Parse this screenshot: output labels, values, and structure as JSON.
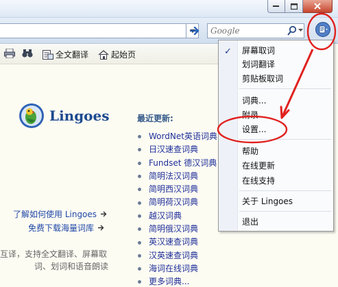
{
  "window": {
    "title": ""
  },
  "address": {
    "value": ""
  },
  "search": {
    "placeholder": "Google"
  },
  "page_toolbar": {
    "items": [
      {
        "label": ""
      },
      {
        "label": ""
      },
      {
        "label": "全文翻译"
      },
      {
        "label": "起始页"
      }
    ]
  },
  "home": {
    "logo_text": "Lingoes",
    "links": [
      "了解如何使用 Lingoes",
      "免费下载海量词库"
    ],
    "description_lines": [
      "互译，支持全文翻译、屏幕取",
      "词、划词和语音朗读"
    ]
  },
  "recent": {
    "title": "最近更新:",
    "items": [
      "WordNet英语词典",
      "日汉速查词典",
      "Fundset 德汉词典",
      "简明法汉词典",
      "简明西汉词典",
      "简明荷汉词典",
      "越汉词典",
      "简明俄汉词典",
      "英汉速查词典",
      "汉英速查词典",
      "海词在线词典",
      "更多词典..."
    ]
  },
  "menu": {
    "checked_index": 0,
    "items": [
      "屏幕取词",
      "划词翻译",
      "剪贴板取词",
      "词典...",
      "附录",
      "设置...",
      "帮助",
      "在线更新",
      "在线支持",
      "关于 Lingoes",
      "退出"
    ]
  },
  "colors": {
    "annotation": "#e0211e",
    "link": "#1f47a8",
    "list_text": "#1f2f9a"
  }
}
